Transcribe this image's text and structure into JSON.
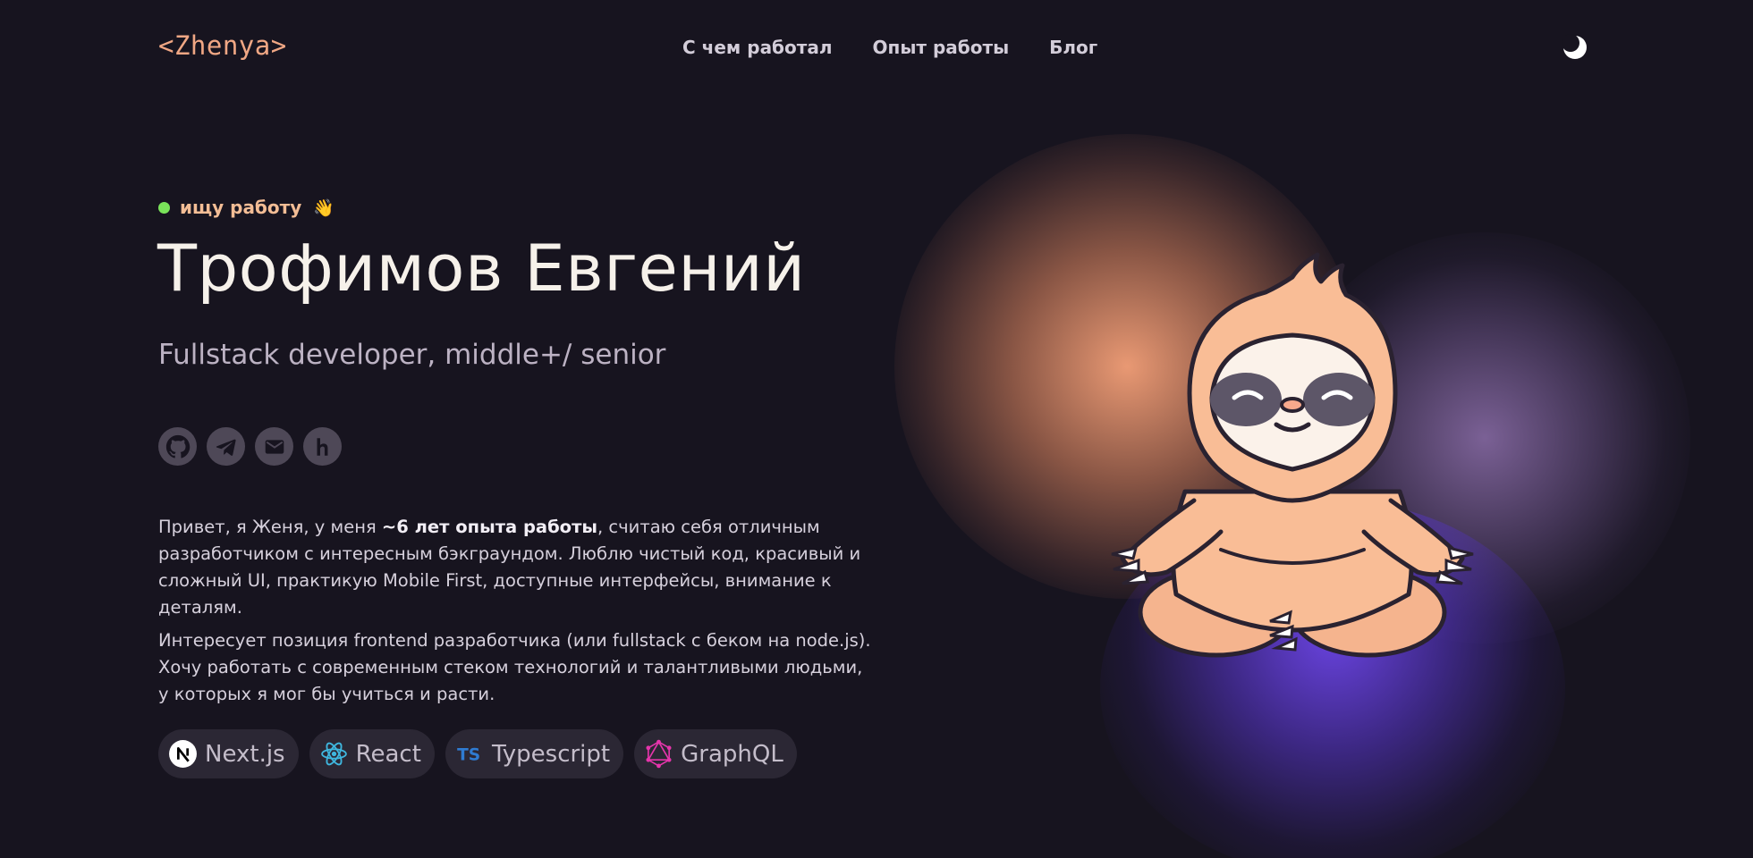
{
  "header": {
    "logo": "<Zhenya>",
    "nav": [
      "С чем работал",
      "Опыт работы",
      "Блог"
    ],
    "theme_toggle_icon": "moon-icon"
  },
  "hero": {
    "status": "ищу работу",
    "status_emoji": "👋",
    "status_color": "#7ae35a",
    "name": "Трофимов Евгений",
    "role": "Fullstack developer, middle+/ senior",
    "socials": [
      {
        "icon": "github-icon"
      },
      {
        "icon": "telegram-icon"
      },
      {
        "icon": "mail-icon"
      },
      {
        "icon": "hh-icon"
      }
    ],
    "about": {
      "p1_before": "Привет, я Женя, у меня ",
      "p1_bold": "~6 лет опыта работы",
      "p1_after": ", считаю себя отличным разработчиком с интересным бэкграундом. Люблю чистый код, красивый и сложный UI, практикую Mobile First, доступные интерфейсы, внимание к деталям.",
      "p2": "Интересует позиция frontend разработчика (или fullstack с беком на node.js). Хочу работать с современным стеком технологий и талантливыми людьми, у которых я мог бы учиться и расти."
    },
    "stack": [
      {
        "label": "Next.js",
        "icon": "nextjs-icon"
      },
      {
        "label": "React",
        "icon": "react-icon"
      },
      {
        "label": "Typescript",
        "icon": "typescript-icon"
      },
      {
        "label": "GraphQL",
        "icon": "graphql-icon"
      }
    ],
    "illustration": "meditating-sloth"
  },
  "colors": {
    "background": "#17141f",
    "accent": "#f0a784",
    "chip_bg": "#2b2734",
    "social_bg": "#4e4857"
  }
}
